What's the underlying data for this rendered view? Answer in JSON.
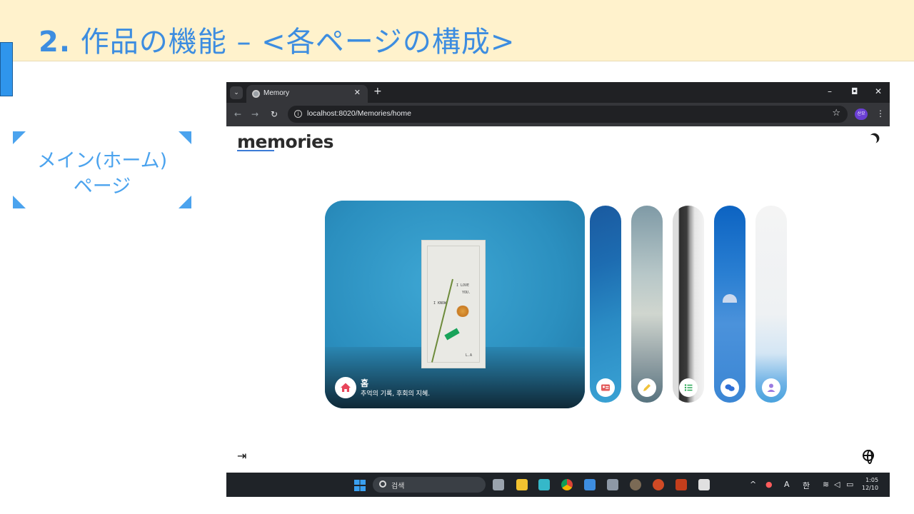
{
  "slide": {
    "title_num": "2.",
    "title_text": " 作品の機能 – <各ページの構成>",
    "section_label_line1": "メイン(ホーム)",
    "section_label_line2": "ページ"
  },
  "browser": {
    "tab_title": "Memory",
    "url": "localhost:8020/Memories/home",
    "profile_badge": "산모"
  },
  "page": {
    "logo": "memories",
    "main_card": {
      "title": "홈",
      "subtitle": "추억의 기록, 후회의 지혜.",
      "paper_lines": [
        "I LOVE",
        "YOU.",
        "I KNOW",
        "L.A"
      ]
    },
    "pills": [
      {
        "icon": "id-card-icon"
      },
      {
        "icon": "pencil-icon"
      },
      {
        "icon": "list-icon"
      },
      {
        "icon": "chat-icon"
      },
      {
        "icon": "user-icon"
      }
    ]
  },
  "taskbar": {
    "search_text": "검색",
    "tray_a": "A",
    "tray_lang": "한",
    "time": "1:05",
    "date": "12/10"
  },
  "colors": {
    "title_blue": "#3d8de0",
    "header_bg": "#fff2cc",
    "label_blue": "#4ba3ee",
    "home_icon_red": "#e8455a"
  }
}
